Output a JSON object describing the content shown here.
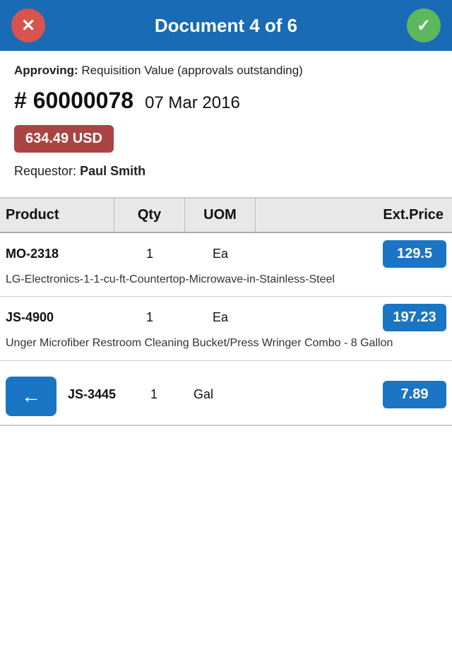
{
  "header": {
    "title": "Document 4 of 6",
    "close_label": "✕",
    "check_label": "✓"
  },
  "approving": {
    "label": "Approving:",
    "text": " Requisition Value (approvals outstanding)"
  },
  "document": {
    "number_prefix": "#",
    "number": "60000078",
    "date": "07 Mar 2016"
  },
  "amount": {
    "value": "634.49 USD"
  },
  "requestor": {
    "label": "Requestor:",
    "name": "Paul Smith"
  },
  "table": {
    "headers": {
      "product": "Product",
      "qty": "Qty",
      "uom": "UOM",
      "price": "Ext.Price"
    },
    "items": [
      {
        "product": "MO-2318",
        "qty": "1",
        "uom": "Ea",
        "price": "129.5",
        "description": "LG-Electronics-1-1-cu-ft-Countertop-Microwave-in-Stainless-Steel"
      },
      {
        "product": "JS-4900",
        "qty": "1",
        "uom": "Ea",
        "price": "197.23",
        "description": "Unger Microfiber Restroom Cleaning Bucket/Press Wringer Combo - 8 Gallon"
      },
      {
        "product": "JS-3445",
        "qty": "1",
        "uom": "Gal",
        "price": "7.89",
        "description": ""
      }
    ]
  },
  "back_button_icon": "←"
}
